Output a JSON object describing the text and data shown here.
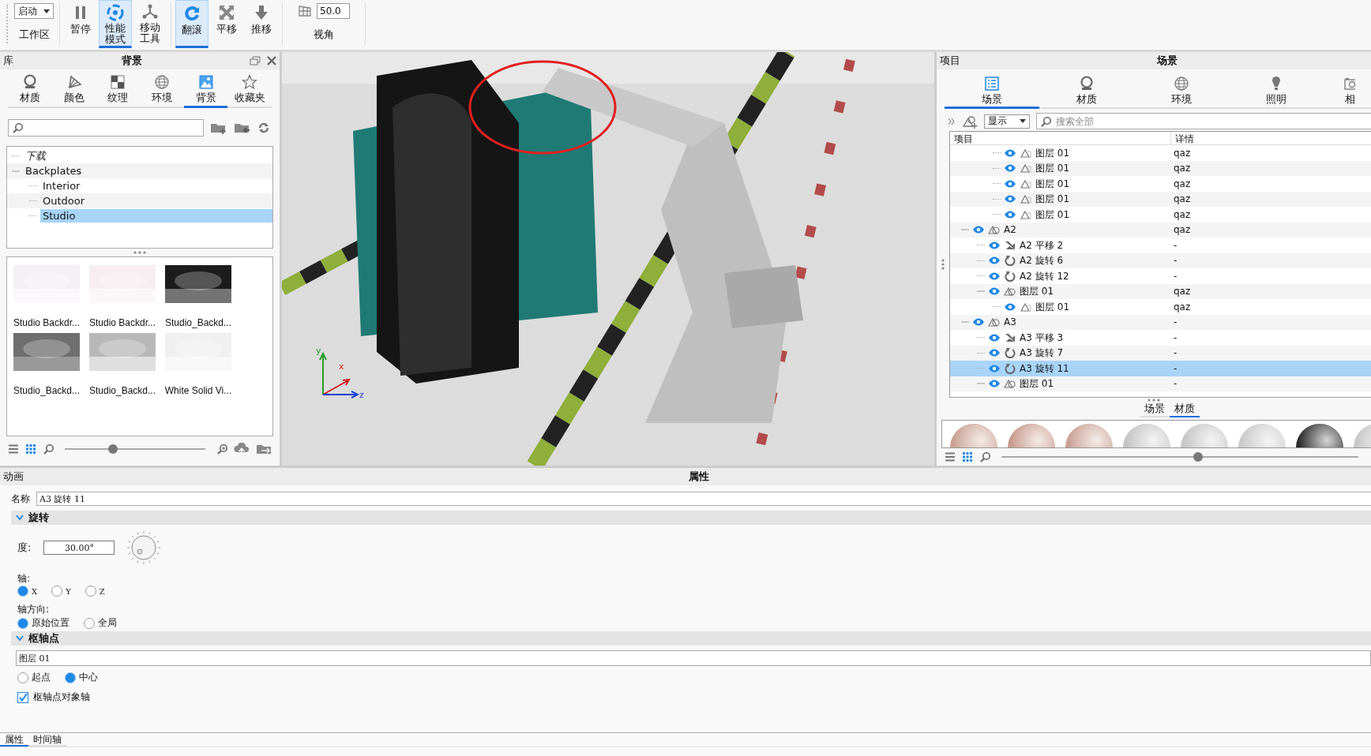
{
  "toolbar": {
    "items": [
      {
        "kind": "dropdown",
        "value": "启动",
        "label": "工作区"
      },
      {
        "kind": "pause",
        "label": "暂停",
        "selected": false
      },
      {
        "kind": "performance",
        "label": "性能模式",
        "selected": true
      },
      {
        "kind": "move-tool",
        "label": "移动工具",
        "selected": false
      },
      {
        "kind": "tumble",
        "label": "翻滚",
        "selected": true
      },
      {
        "kind": "pan",
        "label": "平移",
        "selected": false
      },
      {
        "kind": "dolly",
        "label": "推移",
        "selected": false
      },
      {
        "kind": "view-angle",
        "value": "50.0",
        "label": "视角"
      }
    ]
  },
  "library": {
    "header": "库",
    "title": "背景",
    "tabs": [
      {
        "kind": "material",
        "label": "材质",
        "selected": false
      },
      {
        "kind": "color",
        "label": "颜色",
        "selected": false
      },
      {
        "kind": "texture",
        "label": "纹理",
        "selected": false
      },
      {
        "kind": "environment",
        "label": "环境",
        "selected": false
      },
      {
        "kind": "background",
        "label": "背景",
        "selected": true
      },
      {
        "kind": "favorites",
        "label": "收藏夹",
        "selected": false
      }
    ],
    "tree": [
      {
        "label": "下载",
        "italic": true,
        "selected": false
      },
      {
        "label": "Backplates",
        "italic": false,
        "expanded": true,
        "selected": false,
        "children": [
          {
            "label": "Interior",
            "italic": false,
            "selected": false
          },
          {
            "label": "Outdoor",
            "italic": false,
            "selected": false
          },
          {
            "label": "Studio",
            "italic": false,
            "selected": true
          }
        ]
      }
    ],
    "thumbnails": [
      {
        "kind": "picture",
        "color": "#f4f0f6",
        "label": "Studio Backdr..."
      },
      {
        "kind": "picture",
        "color": "#f6eef0",
        "label": "Studio Backdr..."
      },
      {
        "kind": "picture",
        "color": "#1c1c1c",
        "label": "Studio_Backd..."
      },
      {
        "kind": "picture",
        "color": "#6e6e6e",
        "label": "Studio_Backd..."
      },
      {
        "kind": "picture",
        "color": "#b8b8b8",
        "label": "Studio_Backd..."
      },
      {
        "kind": "picture",
        "color": "#f0f0f0",
        "label": "White Solid Vi..."
      }
    ],
    "views": [
      {
        "kind": "list",
        "selected": false
      },
      {
        "kind": "grid",
        "selected": true
      }
    ],
    "zoom": {
      "level": 0.34
    }
  },
  "viewport": {
    "axes": [
      "y",
      "x",
      "z"
    ]
  },
  "scene": {
    "header": "项目",
    "title": "场景",
    "tabs": [
      {
        "kind": "scene",
        "label": "场景",
        "selected": true
      },
      {
        "kind": "material",
        "label": "材质",
        "selected": false
      },
      {
        "kind": "environment",
        "label": "环境",
        "selected": false
      },
      {
        "kind": "lighting",
        "label": "照明",
        "selected": false
      },
      {
        "kind": "camera",
        "label": "相",
        "selected": false
      }
    ],
    "filter": {
      "value": "显示"
    },
    "search": {
      "placeholder": "搜索全部"
    },
    "columns": [
      "项目",
      "详情"
    ],
    "tree": [
      {
        "children": [
          {
            "children": [
              {
                "children": [
                  {
                    "kind": "layer",
                    "label": "图层 01",
                    "detail": "qaz",
                    "selected": false
                  },
                  {
                    "kind": "layer",
                    "label": "图层 01",
                    "detail": "qaz",
                    "selected": false
                  },
                  {
                    "kind": "layer",
                    "label": "图层 01",
                    "detail": "qaz",
                    "selected": false
                  },
                  {
                    "kind": "layer",
                    "label": "图层 01",
                    "detail": "qaz",
                    "selected": false
                  },
                  {
                    "kind": "layer",
                    "label": "图层 01",
                    "detail": "qaz",
                    "selected": false
                  }
                ]
              }
            ]
          },
          {
            "kind": "group",
            "label": "A2",
            "detail": "qaz",
            "expanded": true,
            "selected": false,
            "children": [
              {
                "kind": "translate",
                "label": "A2 平移 2",
                "detail": "-",
                "selected": false
              },
              {
                "kind": "rotate",
                "label": "A2 旋转 6",
                "detail": "-",
                "selected": false
              },
              {
                "kind": "rotate",
                "label": "A2 旋转 12",
                "detail": "-",
                "selected": false
              },
              {
                "kind": "group",
                "label": "图层 01",
                "detail": "qaz",
                "expanded": true,
                "selected": false,
                "children": [
                  {
                    "kind": "layer",
                    "label": "图层 01",
                    "detail": "qaz",
                    "selected": false
                  }
                ]
              }
            ]
          },
          {
            "kind": "group",
            "label": "A3",
            "detail": "-",
            "expanded": true,
            "selected": false,
            "children": [
              {
                "kind": "translate",
                "label": "A3 平移 3",
                "detail": "-",
                "selected": false
              },
              {
                "kind": "rotate",
                "label": "A3 旋转 7",
                "detail": "-",
                "selected": false
              },
              {
                "kind": "rotate",
                "label": "A3 旋转 11",
                "detail": "-",
                "selected": true
              },
              {
                "kind": "group",
                "label": "图层 01",
                "detail": "-",
                "expanded": true,
                "selected": false
              }
            ]
          }
        ]
      }
    ],
    "bottom_tabs": [
      {
        "label": "场景",
        "selected": false
      },
      {
        "label": "材质",
        "selected": true
      }
    ],
    "swatches": [
      {
        "color": "#c9a090"
      },
      {
        "color": "#c89a8a"
      },
      {
        "color": "#caa092"
      },
      {
        "color": "#c4c4c4"
      },
      {
        "color": "#c6c6c6"
      },
      {
        "color": "#cacaca"
      },
      {
        "color": "#2a2a2a"
      },
      {
        "color": "#c8c8c8"
      }
    ],
    "views": [
      {
        "kind": "list",
        "selected": false
      },
      {
        "kind": "grid",
        "selected": true
      }
    ],
    "zoom": {
      "level": 0.55
    }
  },
  "properties": {
    "header": "动画",
    "title": "属性",
    "name_label": "名称",
    "name": "A3 旋转 11",
    "rotation": {
      "title": "旋转",
      "expanded": true,
      "degree_label": "度:",
      "degree": "30.00°",
      "axis_label": "轴:",
      "axes": [
        {
          "label": "X",
          "selected": true
        },
        {
          "label": "Y",
          "selected": false
        },
        {
          "label": "Z",
          "selected": false
        }
      ],
      "direction_label": "轴方向:",
      "directions": [
        {
          "label": "原始位置",
          "selected": true
        },
        {
          "label": "全局",
          "selected": false
        }
      ]
    },
    "pivot": {
      "title": "枢轴点",
      "expanded": true,
      "object": "图层 01",
      "points": [
        {
          "label": "起点",
          "selected": false
        },
        {
          "label": "中心",
          "selected": true
        }
      ],
      "object_axis": {
        "label": "枢轴点对象轴",
        "checked": true
      }
    },
    "tabs": [
      {
        "label": "属性",
        "selected": true
      },
      {
        "label": "时间轴",
        "selected": false
      }
    ]
  }
}
